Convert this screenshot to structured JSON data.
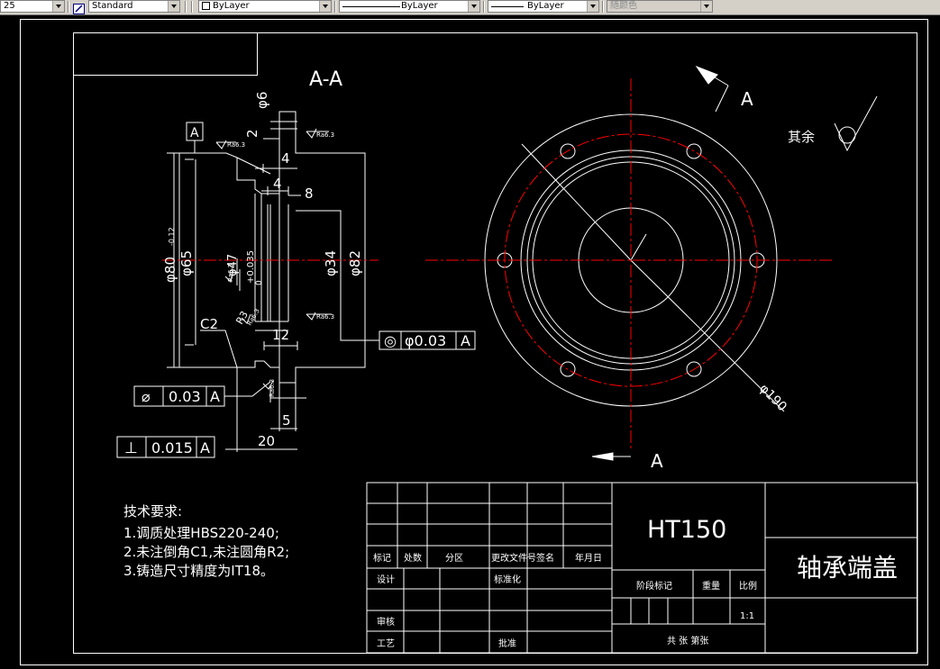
{
  "toolbar": {
    "scale_value": "25",
    "text_style": "Standard",
    "layer": "ByLayer",
    "linetype": "ByLayer",
    "lineweight": "ByLayer",
    "color": "随颜色"
  },
  "section": {
    "title": "A-A",
    "dims": {
      "d6": "φ6",
      "n2": "2",
      "n4a": "4",
      "n4b": "4",
      "n8": "8",
      "d80": "φ80",
      "d80_tol": "-0.12",
      "d65": "φ65",
      "d47": "φ47",
      "tol_upper": "+0.035",
      "tol_lower": "0",
      "d34": "φ34",
      "d82": "φ82",
      "c2": "C2",
      "r3": "R3",
      "n12": "12",
      "n5": "5",
      "n20": "20"
    },
    "roughness": {
      "r1": "Ra6.3",
      "r2": "Ra6.3",
      "r3": "Ra6.3",
      "r4": "Ra6.3",
      "r5": "Ra6.3",
      "r6": "Ra6.3"
    },
    "datum": "A",
    "fcf_runout_top": {
      "symbol": "◎",
      "value": "φ0.03",
      "datum": "A"
    },
    "fcf_circ": {
      "symbol": "⌀",
      "value": "0.03",
      "datum": "A"
    },
    "fcf_perp": {
      "symbol": "⊥",
      "value": "0.015",
      "datum": "A"
    }
  },
  "front_view": {
    "cut_label_top": "A",
    "cut_label_bottom": "A",
    "d190": "φ190"
  },
  "rest_roughness": "其余",
  "tech_req": {
    "heading": "技术要求:",
    "line1": "1.调质处理HBS220-240;",
    "line2": "2.未注倒角C1,未注圆角R2;",
    "line3": "3.铸造尺寸精度为IT18。"
  },
  "title_block": {
    "material": "HT150",
    "part_name": "轴承端盖",
    "headers": [
      "标记",
      "处数",
      "分区",
      "更改文件号",
      "签名",
      "年月日"
    ],
    "design": "设计",
    "standardize": "标准化",
    "review": "审核",
    "process": "工艺",
    "approve": "批准",
    "stage_mark": "阶段标记",
    "weight": "重量",
    "scale_label": "比例",
    "scale": "1:1",
    "sheets": "共  张  第张"
  },
  "colors": {
    "line": "#ffffff",
    "centerline": "#ff0000",
    "background": "#000000"
  }
}
